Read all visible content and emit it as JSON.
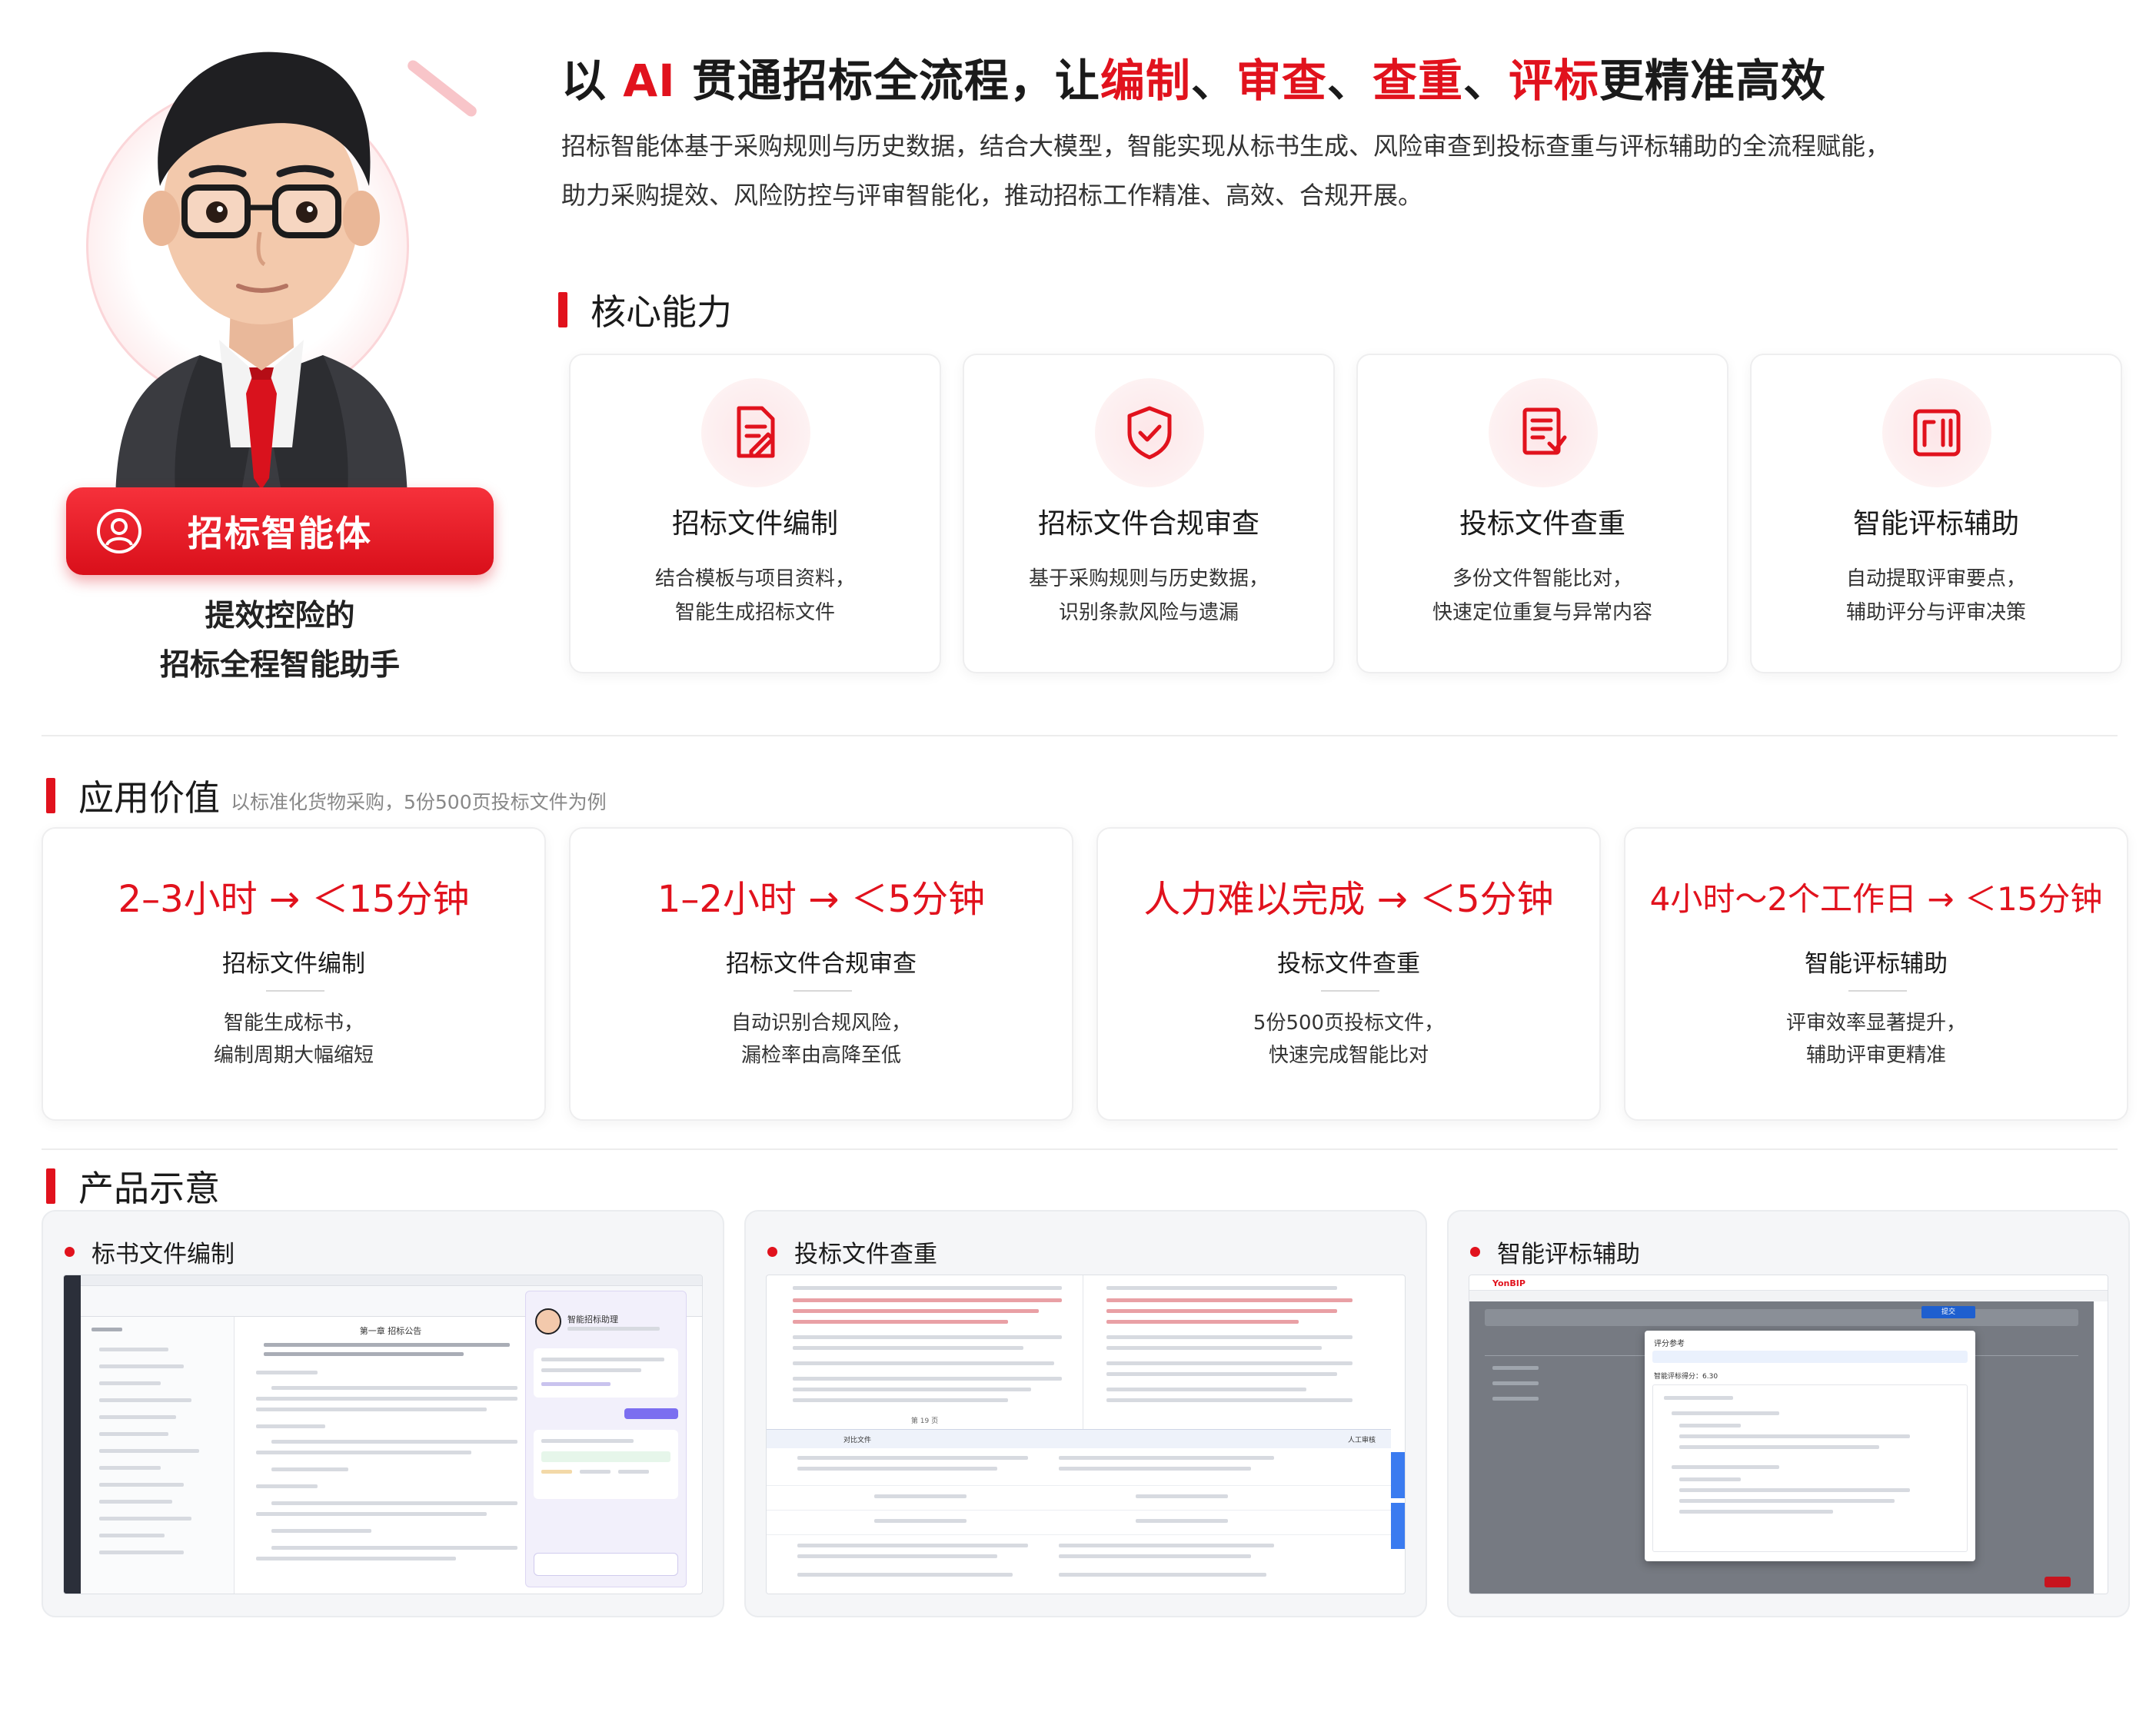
{
  "colors": {
    "accent": "#e1121d",
    "badge_gradient_top": "#f6313b",
    "badge_gradient_bottom": "#d90f1a"
  },
  "agent": {
    "badge_label": "招标智能体",
    "tagline_line1": "提效控险的",
    "tagline_line2": "招标全程智能助手",
    "badge_icon": "user-icon"
  },
  "hero": {
    "title_segments": [
      {
        "text": "以 ",
        "red": false
      },
      {
        "text": "AI",
        "red": true
      },
      {
        "text": " 贯通招标全流程，让",
        "red": false
      },
      {
        "text": "编制",
        "red": true
      },
      {
        "text": "、",
        "red": false
      },
      {
        "text": "审查",
        "red": true
      },
      {
        "text": "、",
        "red": false
      },
      {
        "text": "查重",
        "red": true
      },
      {
        "text": "、",
        "red": false
      },
      {
        "text": "评标",
        "red": true
      },
      {
        "text": "更精准高效",
        "red": false
      }
    ],
    "desc_line1": "招标智能体基于采购规则与历史数据，结合大模型，智能实现从标书生成、风险审查到投标查重与评标辅助的全流程赋能，",
    "desc_line2": "助力采购提效、风险防控与评审智能化，推动招标工作精准、高效、合规开展。"
  },
  "core": {
    "section_title": "核心能力",
    "cards": [
      {
        "title": "招标文件编制",
        "desc1": "结合模板与项目资料，",
        "desc2": "智能生成招标文件",
        "icon": "document-edit-icon"
      },
      {
        "title": "招标文件合规审查",
        "desc1": "基于采购规则与历史数据，",
        "desc2": "识别条款风险与遗漏",
        "icon": "shield-check-icon"
      },
      {
        "title": "投标文件查重",
        "desc1": "多份文件智能比对，",
        "desc2": "快速定位重复与异常内容",
        "icon": "file-compare-icon"
      },
      {
        "title": "智能评标辅助",
        "desc1": "自动提取评审要点，",
        "desc2": "辅助评分与评审决策",
        "icon": "review-panel-icon"
      }
    ]
  },
  "value": {
    "section_title": "应用价值",
    "section_note": "以标准化货物采购，5份500页投标文件为例",
    "cards": [
      {
        "metric": "2–3小时 → ＜15分钟",
        "name": "招标文件编制",
        "desc1": "智能生成标书，",
        "desc2": "编制周期大幅缩短"
      },
      {
        "metric": "1–2小时 → ＜5分钟",
        "name": "招标文件合规审查",
        "desc1": "自动识别合规风险，",
        "desc2": "漏检率由高降至低"
      },
      {
        "metric": "人力难以完成 → ＜5分钟",
        "name": "投标文件查重",
        "desc1": "5份500页投标文件，",
        "desc2": "快速完成智能比对"
      },
      {
        "metric": "4小时～2个工作日 → ＜15分钟",
        "name": "智能评标辅助",
        "desc1": "评审效率显著提升，",
        "desc2": "辅助评审更精准"
      }
    ]
  },
  "product": {
    "section_title": "产品示意",
    "cards": [
      {
        "title": "标书文件编制",
        "shot_heading": "第一章 招标公告",
        "assistant_name": "智能招标助理"
      },
      {
        "title": "投标文件查重",
        "pager": "第 19 页",
        "col_left": "对比文件",
        "col_right": "人工审核"
      },
      {
        "title": "智能评标辅助",
        "brand": "YonBIP",
        "dialog_title": "评分参考",
        "dialog_score": "智能评标得分：6.30",
        "next_button": "提交"
      }
    ]
  }
}
